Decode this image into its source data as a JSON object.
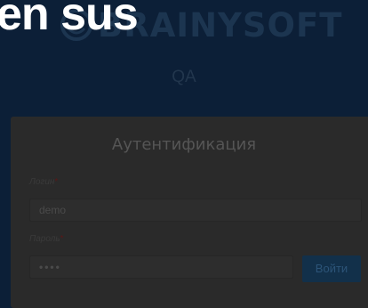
{
  "overlay": {
    "text": "en sus"
  },
  "brand": {
    "name": "BRAINYSOFT"
  },
  "environment": {
    "label": "QA"
  },
  "auth": {
    "title": "Аутентификация",
    "login_label": "Логин",
    "login_value": "demo",
    "password_label": "Пароль",
    "password_value": "••••",
    "required_mark": "*",
    "submit_label": "Войти"
  },
  "colors": {
    "background": "#0c1f37",
    "brand": "#1c3550",
    "button": "#12304a"
  }
}
